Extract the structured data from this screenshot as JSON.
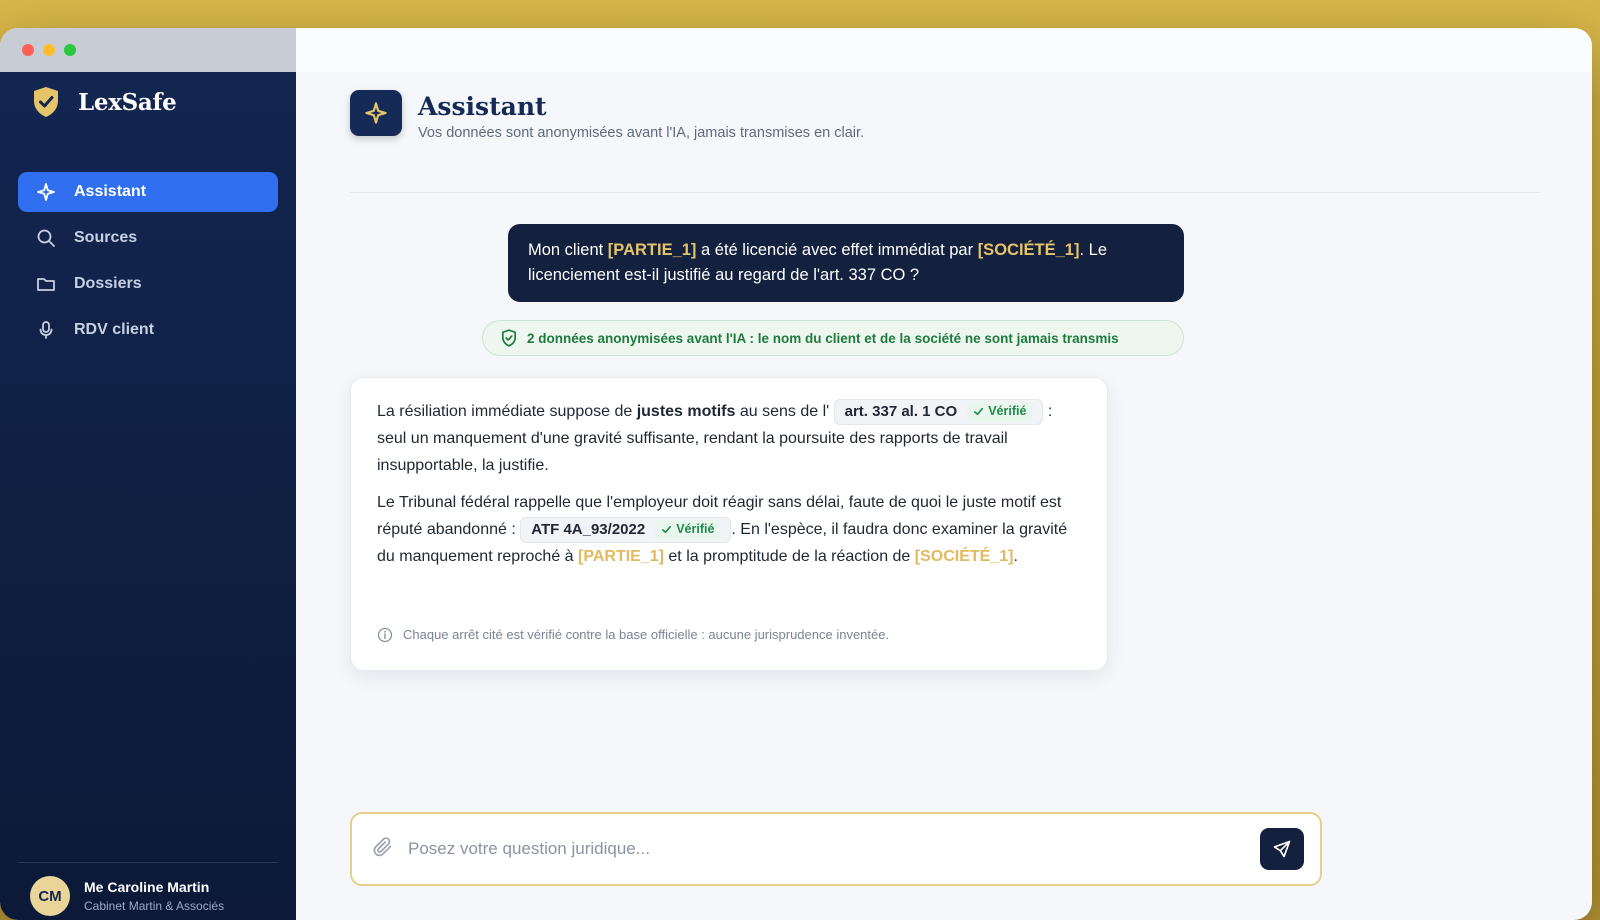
{
  "window": {
    "traffic_lights": {
      "close": "#ff5f57",
      "minimize": "#febc2e",
      "zoom": "#28c840"
    }
  },
  "brand": {
    "name": "LexSafe",
    "logo_icon": "shield-check-icon",
    "accent": "#e6c46a"
  },
  "sidebar": {
    "items": [
      {
        "label": "Assistant",
        "icon": "sparkle-icon",
        "active": true
      },
      {
        "label": "Sources",
        "icon": "search-icon",
        "active": false
      },
      {
        "label": "Dossiers",
        "icon": "folder-icon",
        "active": false
      },
      {
        "label": "RDV client",
        "icon": "microphone-icon",
        "active": false
      }
    ],
    "user": {
      "initials": "CM",
      "name": "Me Caroline Martin",
      "firm": "Cabinet Martin & Associés"
    }
  },
  "header": {
    "title": "Assistant",
    "subtitle": "Vos données sont anonymisées avant l'IA, jamais transmises en clair."
  },
  "conversation": {
    "user_message": {
      "p1": "Mon client ",
      "t1": "[PARTIE_1]",
      "p2": " a été licencié avec effet immédiat par ",
      "t2": "[SOCIÉTÉ_1]",
      "p3": ". Le licenciement est-il justifié au regard de l'art. 337 CO ?"
    },
    "anonymization_notice": "2 données anonymisées avant l'IA : le nom du client et de la société ne sont jamais transmis",
    "answer": {
      "para1": {
        "a": "La résiliation immédiate suppose de ",
        "bold": "justes motifs",
        "b": " au sens de l'",
        "cite": "art. 337 al. 1 CO",
        "cite_badge": "Vérifié",
        "c": " : seul un manquement d'une gravité suffisante, rendant la poursuite des rapports de travail insupportable, la justifie."
      },
      "para2": {
        "a": "Le Tribunal fédéral rappelle que l'employeur doit réagir sans délai, faute de quoi le juste motif est réputé abandonné : ",
        "cite": "ATF 4A_93/2022",
        "cite_badge": "Vérifié",
        "b": ". En l'espèce, il faudra donc examiner la gravité du manquement reproché à ",
        "t1": "[PARTIE_1]",
        "c": " et la promptitude de la réaction de ",
        "t2": "[SOCIÉTÉ_1]",
        "d": "."
      },
      "footnote": "Chaque arrêt cité est vérifié contre la base officielle : aucune jurisprudence inventée."
    }
  },
  "composer": {
    "placeholder": "Posez votre question juridique...",
    "attach_icon": "paperclip-icon",
    "send_icon": "send-icon"
  }
}
